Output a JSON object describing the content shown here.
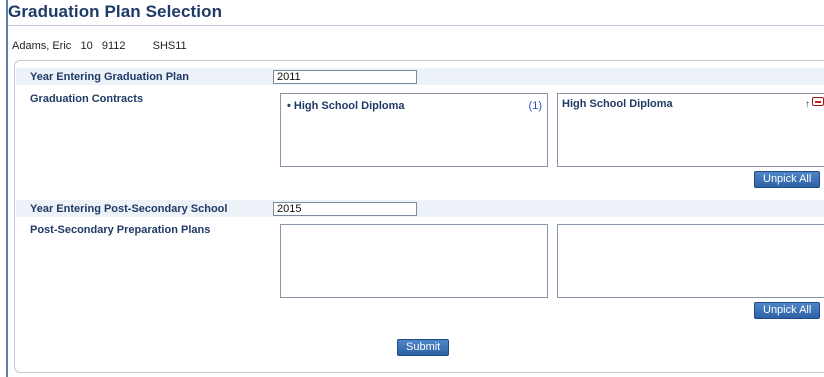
{
  "page": {
    "title": "Graduation Plan Selection"
  },
  "student": {
    "name": "Adams, Eric",
    "grade": "10",
    "id": "9112",
    "school": "SHS11"
  },
  "graduation": {
    "year_label": "Year Entering Graduation Plan",
    "year_value": "2011",
    "contracts_label": "Graduation Contracts",
    "available": [
      {
        "bullet": "•",
        "label": "High School Diploma",
        "count": "(1)"
      }
    ],
    "selected": [
      {
        "label": "High School Diploma",
        "move_up": "↑"
      }
    ],
    "unpick_all_label": "Unpick All"
  },
  "post_secondary": {
    "year_label": "Year Entering Post-Secondary School",
    "year_value": "2015",
    "plans_label": "Post-Secondary Preparation Plans",
    "available": [],
    "selected": [],
    "unpick_all_label": "Unpick All"
  },
  "submit_label": "Submit",
  "colors": {
    "title": "#1f3a66",
    "band": "#edf1f8",
    "button": "#2d62a6",
    "remove": "#cc1f1f",
    "count": "#2b4fc2"
  }
}
